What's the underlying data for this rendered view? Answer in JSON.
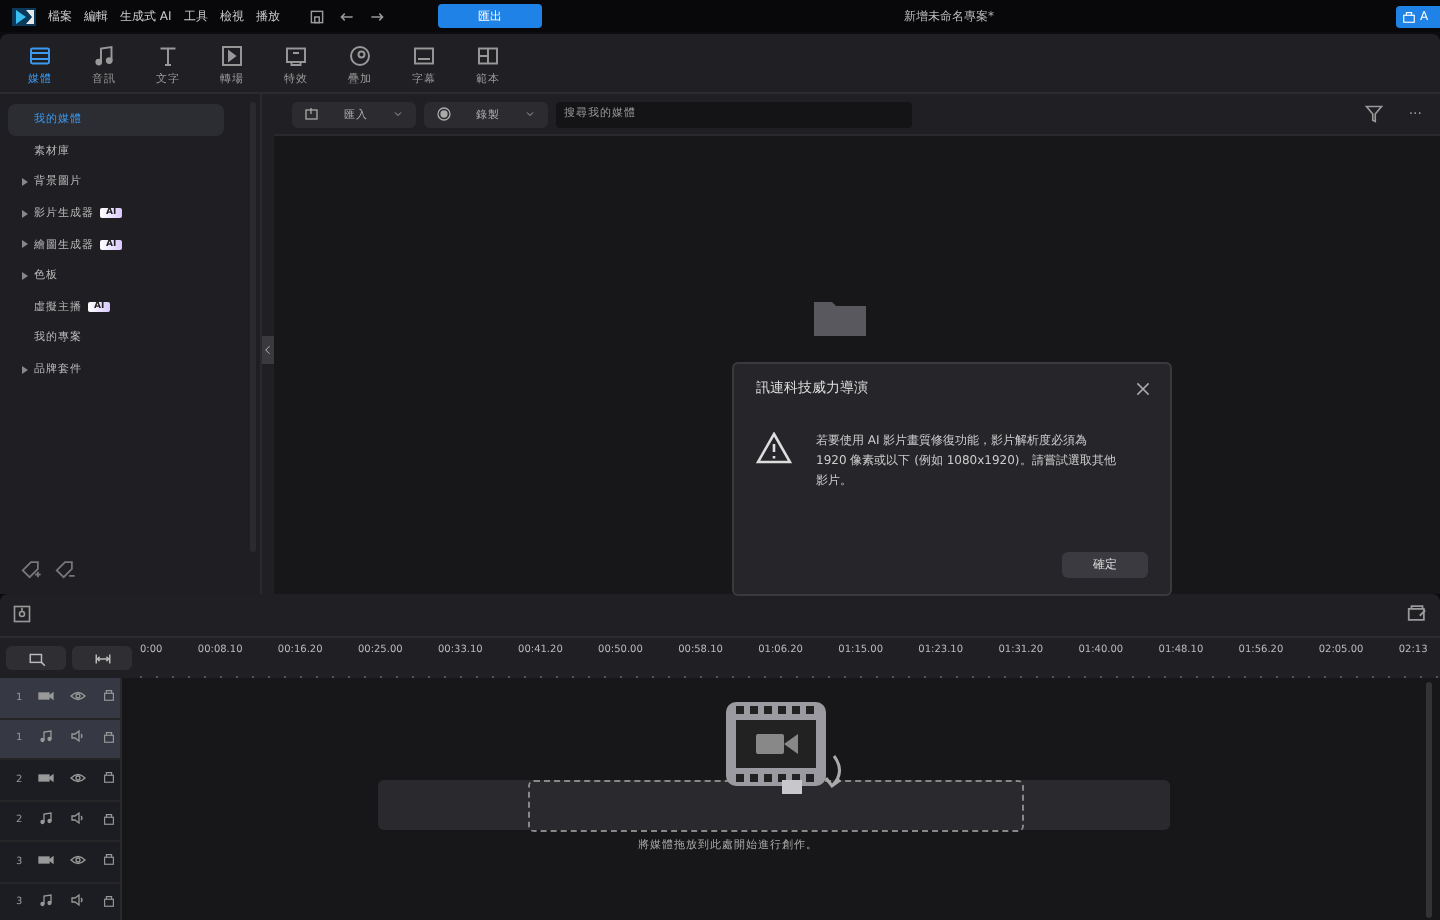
{
  "menu": [
    "檔案",
    "編輯",
    "生成式 AI",
    "工具",
    "檢視",
    "播放"
  ],
  "export_button": "匯出",
  "window": {
    "title": "新增未命名專案*"
  },
  "corner_button": "A",
  "tabs": [
    {
      "label": "媒體",
      "kind": "media",
      "selected": true
    },
    {
      "label": "音訊",
      "kind": "audio",
      "selected": false
    },
    {
      "label": "文字",
      "kind": "text",
      "selected": false
    },
    {
      "label": "轉場",
      "kind": "transition",
      "selected": false
    },
    {
      "label": "特效",
      "kind": "effect",
      "selected": false
    },
    {
      "label": "疊加",
      "kind": "overlay",
      "selected": false
    },
    {
      "label": "字幕",
      "kind": "subtitle",
      "selected": false
    },
    {
      "label": "範本",
      "kind": "template",
      "selected": false
    }
  ],
  "sidebar": {
    "items": [
      {
        "label": "我的媒體",
        "expandable": false,
        "selected": true
      },
      {
        "label": "素材庫",
        "expandable": false,
        "selected": false
      },
      {
        "label": "背景圖片",
        "expandable": true,
        "selected": false
      },
      {
        "label": "影片生成器",
        "badge": "AI",
        "expandable": true,
        "selected": false
      },
      {
        "label": "繪圖生成器",
        "badge": "AI",
        "expandable": true,
        "selected": false
      },
      {
        "label": "色板",
        "expandable": true,
        "selected": false
      },
      {
        "label": "虛擬主播",
        "badge": "AI",
        "expandable": false,
        "selected": false
      },
      {
        "label": "我的專案",
        "expandable": false,
        "selected": false
      },
      {
        "label": "品牌套件",
        "expandable": true,
        "selected": false
      }
    ]
  },
  "media_toolbar": {
    "import": "匯入",
    "record": "錄製",
    "search": {
      "placeholder": "搜尋我的媒體"
    },
    "more": "···"
  },
  "dialog": {
    "title": "訊連科技威力導演",
    "message": "若要使用 AI 影片畫質修復功能，影片解析度必須為 1920 像素或以下 (例如 1080x1920)。請嘗試選取其他影片。",
    "button": "確定"
  },
  "timeline": {
    "ruler": [
      "0:00",
      "00:08.10",
      "00:16.20",
      "00:25.00",
      "00:33.10",
      "00:41.20",
      "00:50.00",
      "00:58.10",
      "01:06.20",
      "01:15.00",
      "01:23.10",
      "01:31.20",
      "01:40.00",
      "01:48.10",
      "01:56.20",
      "02:05.00",
      "02:13"
    ],
    "tracks": [
      {
        "number": "1",
        "kind": "video",
        "selected": true
      },
      {
        "number": "1",
        "kind": "audio",
        "selected": true
      },
      {
        "number": "2",
        "kind": "video",
        "selected": false
      },
      {
        "number": "2",
        "kind": "audio",
        "selected": false
      },
      {
        "number": "3",
        "kind": "video",
        "selected": false
      },
      {
        "number": "3",
        "kind": "audio",
        "selected": false
      }
    ],
    "drop_hint": "將媒體拖放到此處開始進行創作。"
  }
}
